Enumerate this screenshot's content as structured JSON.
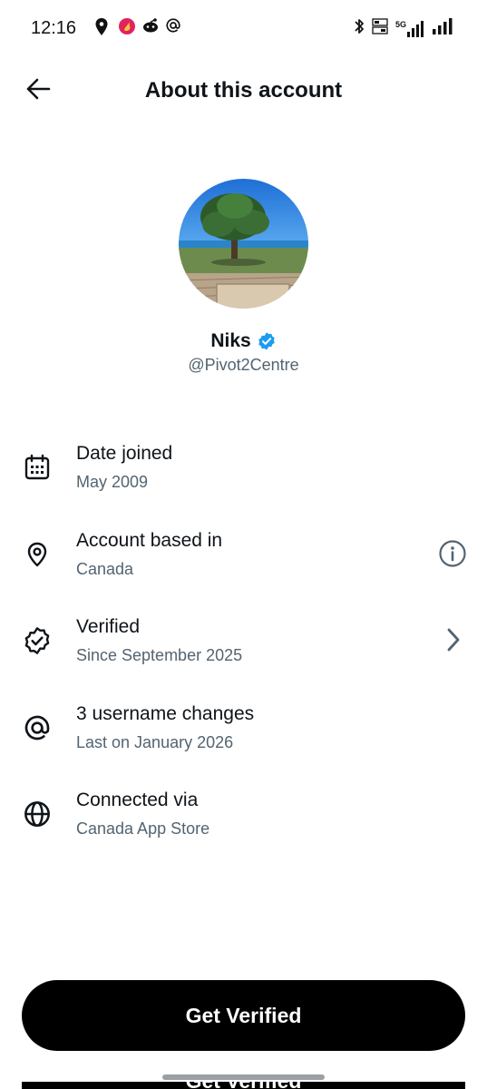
{
  "status_bar": {
    "time": "12:16",
    "left_icons": [
      "location-pin-icon",
      "app-flame-icon",
      "reddit-icon",
      "at-sign-icon"
    ],
    "right_icons": [
      "bluetooth-icon",
      "volte-icon",
      "5g-signal-icon",
      "cell-signal-icon"
    ],
    "network_label": "5G"
  },
  "header": {
    "title": "About this account",
    "back_icon": "arrow-left-icon"
  },
  "profile": {
    "name": "Niks",
    "handle": "@Pivot2Centre",
    "verified": true,
    "badge_color": "#1d9bf0"
  },
  "info_items": [
    {
      "icon": "calendar-icon",
      "title": "Date joined",
      "subtitle": "May 2009",
      "action": ""
    },
    {
      "icon": "location-pin-icon",
      "title": "Account based in",
      "subtitle": "Canada",
      "action": "info-icon"
    },
    {
      "icon": "verified-badge-outline-icon",
      "title": "Verified",
      "subtitle": "Since September 2025",
      "action": "chevron-right-icon"
    },
    {
      "icon": "at-sign-icon",
      "title": "3 username changes",
      "subtitle": "Last on January 2026",
      "action": ""
    },
    {
      "icon": "globe-icon",
      "title": "Connected via",
      "subtitle": "Canada App Store",
      "action": ""
    }
  ],
  "cta": {
    "label": "Get Verified",
    "peek_label": "Get Verified"
  },
  "colors": {
    "text_primary": "#0f1419",
    "text_secondary": "#536471",
    "cta_background": "#000000",
    "cta_text": "#ffffff"
  }
}
